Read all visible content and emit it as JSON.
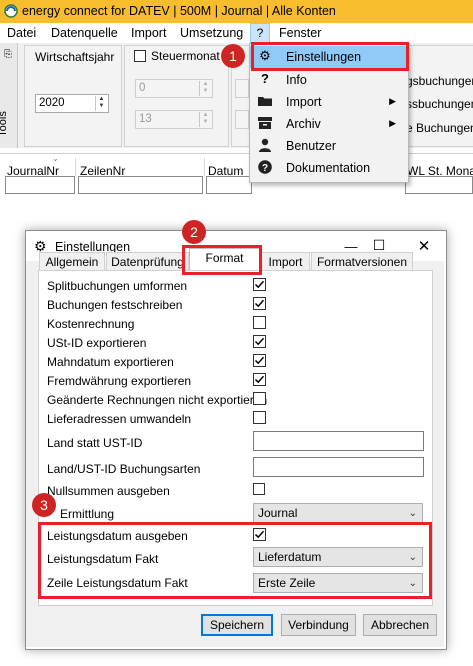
{
  "app": {
    "title": "energy connect for DATEV | 500M | Journal | Alle Konten"
  },
  "menubar": {
    "items": [
      "Datei",
      "Datenquelle",
      "Import",
      "Umsetzung",
      "?",
      "Fenster"
    ]
  },
  "toolbar": {
    "tools_label": "Tools",
    "wirtschaftsjahr_label": "Wirtschaftsjahr",
    "year_value": "2020",
    "steuermonat_label": "Steuermonat",
    "spin_top_value": "0",
    "spin_bottom_value": "13",
    "right_labels": [
      "gsbuchungen",
      "ssbuchungen",
      "e Buchungen"
    ]
  },
  "grid": {
    "columns": [
      "JournalNr",
      "ZeilenNr",
      "Datum",
      "WL St. Monat"
    ]
  },
  "dropdown": {
    "items": [
      {
        "label": "Einstellungen",
        "icon": "gear-icon",
        "submenu": false
      },
      {
        "label": "Info",
        "icon": "question-icon",
        "submenu": false
      },
      {
        "label": "Import",
        "icon": "folder-icon",
        "submenu": true
      },
      {
        "label": "Archiv",
        "icon": "archive-icon",
        "submenu": true
      },
      {
        "label": "Benutzer",
        "icon": "user-icon",
        "submenu": false
      },
      {
        "label": "Dokumentation",
        "icon": "help-circle-icon",
        "submenu": false
      }
    ]
  },
  "badges": [
    "1",
    "2",
    "3"
  ],
  "dialog": {
    "title": "Einstellungen",
    "tabs": [
      "Allgemein",
      "Datenprüfung",
      "Format",
      "Import",
      "Formatversionen"
    ],
    "active_tab": "Format",
    "rows": [
      {
        "label": "Splitbuchungen umformen",
        "type": "checkbox",
        "checked": true
      },
      {
        "label": "Buchungen festschreiben",
        "type": "checkbox",
        "checked": true
      },
      {
        "label": "Kostenrechnung",
        "type": "checkbox",
        "checked": false
      },
      {
        "label": "USt-ID exportieren",
        "type": "checkbox",
        "checked": true
      },
      {
        "label": "Mahndatum exportieren",
        "type": "checkbox",
        "checked": true
      },
      {
        "label": "Fremdwährung exportieren",
        "type": "checkbox",
        "checked": true
      },
      {
        "label": "Geänderte Rechnungen nicht exportieren",
        "type": "checkbox",
        "checked": false
      },
      {
        "label": "Lieferadressen umwandeln",
        "type": "checkbox",
        "checked": false
      },
      {
        "label": "Land statt UST-ID",
        "type": "text",
        "value": ""
      },
      {
        "label": "Land/UST-ID Buchungsarten",
        "type": "text",
        "value": ""
      },
      {
        "label": "Nullsummen ausgeben",
        "type": "checkbox",
        "checked": false
      },
      {
        "label": "Ermittlung",
        "type": "select",
        "value": "Journal"
      },
      {
        "label": "Leistungsdatum ausgeben",
        "type": "checkbox",
        "checked": true
      },
      {
        "label": "Leistungsdatum Fakt",
        "type": "select",
        "value": "Lieferdatum"
      },
      {
        "label": "Zeile Leistungsdatum Fakt",
        "type": "select",
        "value": "Erste Zeile"
      }
    ],
    "buttons": {
      "save": "Speichern",
      "connection": "Verbindung",
      "cancel": "Abbrechen"
    }
  },
  "colors": {
    "titlebar": "#f7bd2c",
    "highlight": "#91c9f7",
    "annotation_red": "#e8202a",
    "badge_red": "#cf2424"
  }
}
